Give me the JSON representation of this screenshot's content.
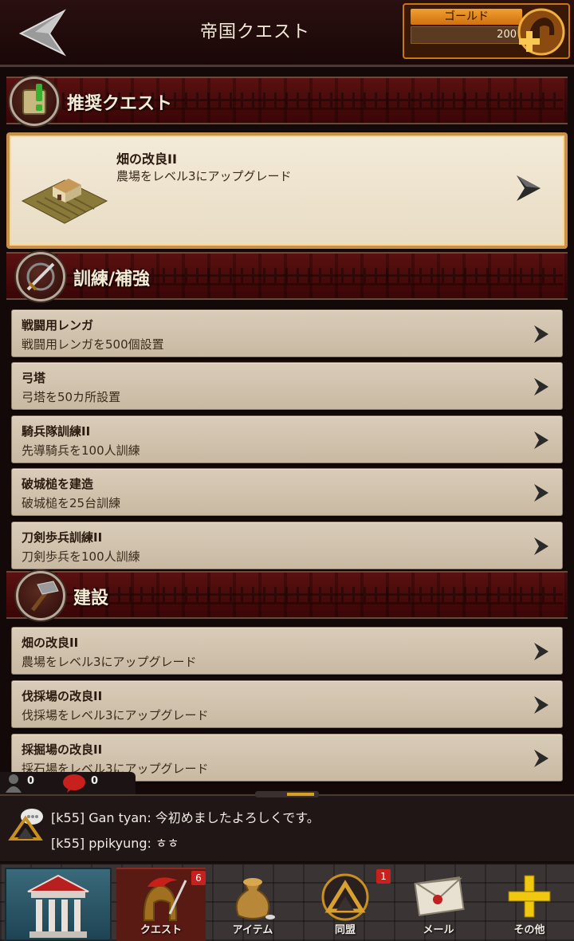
{
  "header": {
    "title": "帝国クエスト",
    "gold_label": "ゴールド",
    "gold_value": "200"
  },
  "sections": {
    "recommended": {
      "title": "推奨クエスト",
      "card": {
        "title": "畑の改良II",
        "desc": "農場をレベル3にアップグレード"
      }
    },
    "training": {
      "title": "訓練/補強",
      "items": [
        {
          "title": "戦闘用レンガ",
          "desc": "戦闘用レンガを500個設置"
        },
        {
          "title": "弓塔",
          "desc": "弓塔を50カ所設置"
        },
        {
          "title": "騎兵隊訓練II",
          "desc": "先導騎兵を100人訓練"
        },
        {
          "title": "破城槌を建造",
          "desc": "破城槌を25台訓練"
        },
        {
          "title": "刀剣歩兵訓練II",
          "desc": "刀剣歩兵を100人訓練"
        }
      ]
    },
    "construction": {
      "title": "建設",
      "items": [
        {
          "title": "畑の改良II",
          "desc": "農場をレベル3にアップグレード"
        },
        {
          "title": "伐採場の改良II",
          "desc": "伐採場をレベル3にアップグレード"
        },
        {
          "title": "採掘場の改良II",
          "desc": "採石場をレベル3にアップグレード"
        }
      ]
    }
  },
  "chat": {
    "online_count": "0",
    "unread_count": "0",
    "messages": [
      "[k55] Gan tyan: 今初めましたよろしくです。",
      "[k55] ppikyung: ㅎㅎ"
    ]
  },
  "nav": {
    "items": [
      {
        "label": ""
      },
      {
        "label": "クエスト",
        "badge": "6"
      },
      {
        "label": "アイテム"
      },
      {
        "label": "同盟",
        "badge": "1"
      },
      {
        "label": "メール"
      },
      {
        "label": "その他"
      }
    ]
  },
  "colors": {
    "accent_gold": "#d07010",
    "panel_red": "#5a1010",
    "card_bg": "#f3ead8",
    "badge_red": "#c8201c"
  }
}
